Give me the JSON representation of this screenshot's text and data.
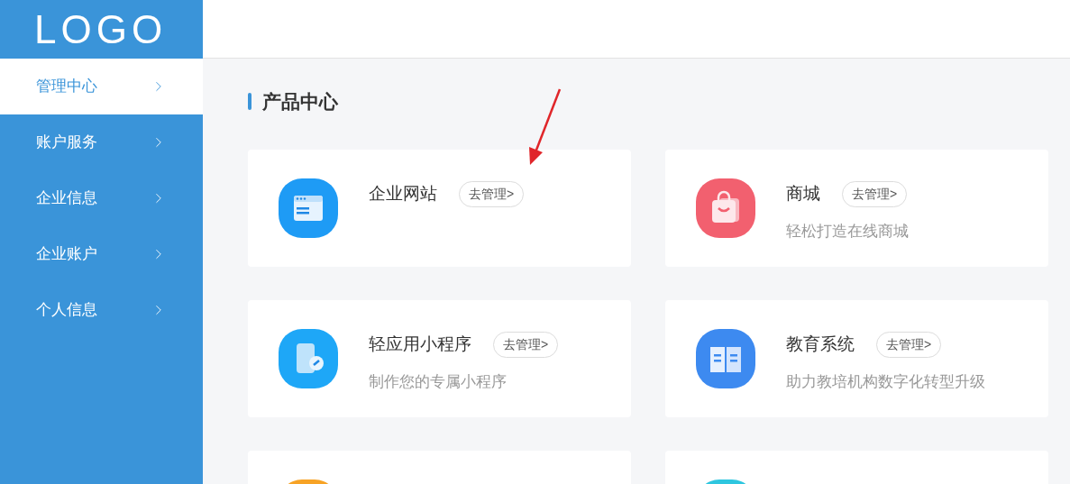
{
  "logo": "LOGO",
  "sidebar": {
    "items": [
      {
        "label": "管理中心",
        "selected": true
      },
      {
        "label": "账户服务",
        "selected": false
      },
      {
        "label": "企业信息",
        "selected": false
      },
      {
        "label": "企业账户",
        "selected": false
      },
      {
        "label": "个人信息",
        "selected": false
      }
    ]
  },
  "section_title": "产品中心",
  "products": [
    {
      "kind": "browser",
      "color": "#1e9bf5",
      "name": "企业网站",
      "action": "去管理>"
    },
    {
      "kind": "bag",
      "color": "#f2606f",
      "name": "商城",
      "action": "去管理>",
      "description": "轻松打造在线商城"
    },
    {
      "kind": "phone",
      "color": "#1ea7f7",
      "name": "轻应用小程序",
      "action": "去管理>",
      "description": "制作您的专属小程序"
    },
    {
      "kind": "book",
      "color": "#3d8af0",
      "name": "教育系统",
      "action": "去管理>",
      "description": "助力教培机构数字化转型升级"
    },
    {
      "kind": "blank",
      "color": "#f7a325"
    },
    {
      "kind": "blank",
      "color": "#2ec6df"
    }
  ]
}
